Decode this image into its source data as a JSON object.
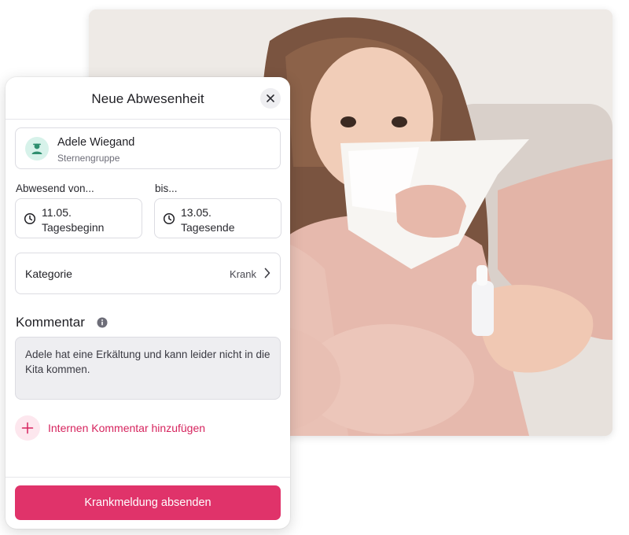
{
  "photo": {
    "icon": "child-with-tissue-photo"
  },
  "dialog": {
    "title": "Neue Abwesenheit",
    "close_icon": "close-icon"
  },
  "person": {
    "name": "Adele Wiegand",
    "group": "Sternengruppe",
    "avatar_icon": "child-avatar-icon"
  },
  "absence": {
    "from_label": "Abwesend von...",
    "to_label": "bis...",
    "from_date": "11.05.",
    "from_sub": "Tagesbeginn",
    "to_date": "13.05.",
    "to_sub": "Tagesende"
  },
  "category": {
    "label": "Kategorie",
    "value": "Krank"
  },
  "comment": {
    "title": "Kommentar",
    "text": "Adele hat eine Erkältung und kann leider nicht in die Kita kommen."
  },
  "internal_comment": {
    "label": "Internen Kommentar hinzufügen"
  },
  "submit": {
    "label": "Krankmeldung absenden"
  },
  "colors": {
    "accent": "#e0336a",
    "accent_text": "#d6245e",
    "avatar_bg": "#d7f2ea",
    "avatar_fg": "#2f8f6f"
  }
}
